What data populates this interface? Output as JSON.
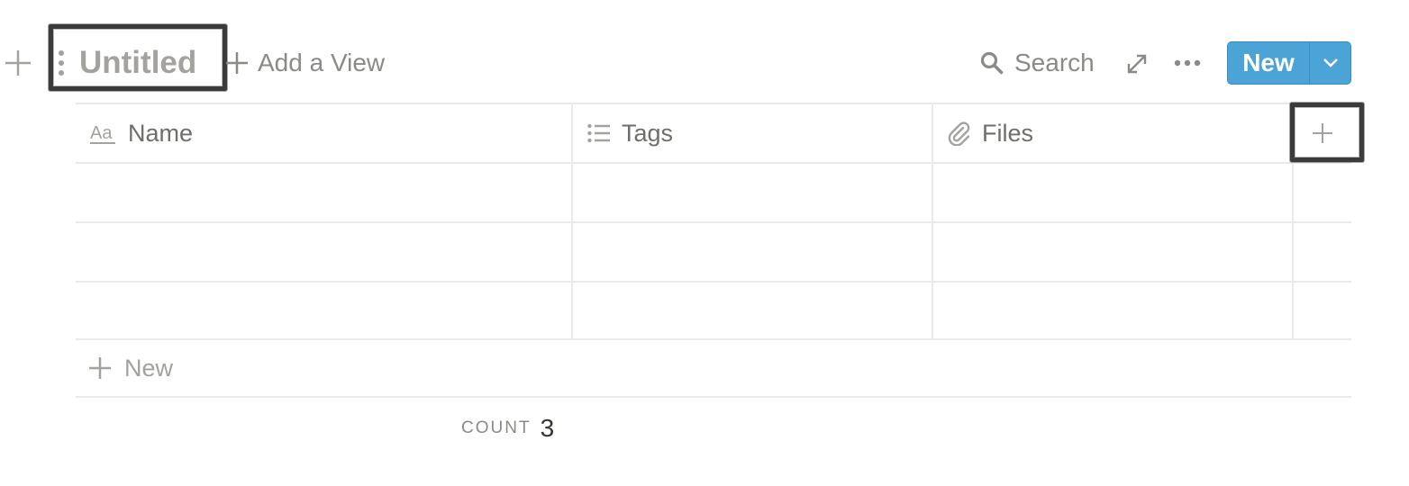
{
  "toolbar": {
    "title": "Untitled",
    "add_view_label": "Add a View",
    "search_label": "Search",
    "new_button_label": "New",
    "icons": {
      "add": "plus-icon",
      "drag": "drag-handle-icon",
      "search": "search-icon",
      "expand": "expand-icon",
      "more": "more-icon",
      "dropdown": "chevron-down-icon"
    },
    "accent_color": "#4ba3d6"
  },
  "table": {
    "columns": [
      {
        "label": "Name",
        "icon": "text-icon"
      },
      {
        "label": "Tags",
        "icon": "list-icon"
      },
      {
        "label": "Files",
        "icon": "paperclip-icon"
      }
    ],
    "add_column_icon": "plus-icon",
    "rows": [
      {
        "name": "",
        "tags": "",
        "files": ""
      },
      {
        "name": "",
        "tags": "",
        "files": ""
      },
      {
        "name": "",
        "tags": "",
        "files": ""
      }
    ],
    "new_row_label": "New"
  },
  "footer": {
    "count_label": "COUNT",
    "count_value": "3"
  }
}
